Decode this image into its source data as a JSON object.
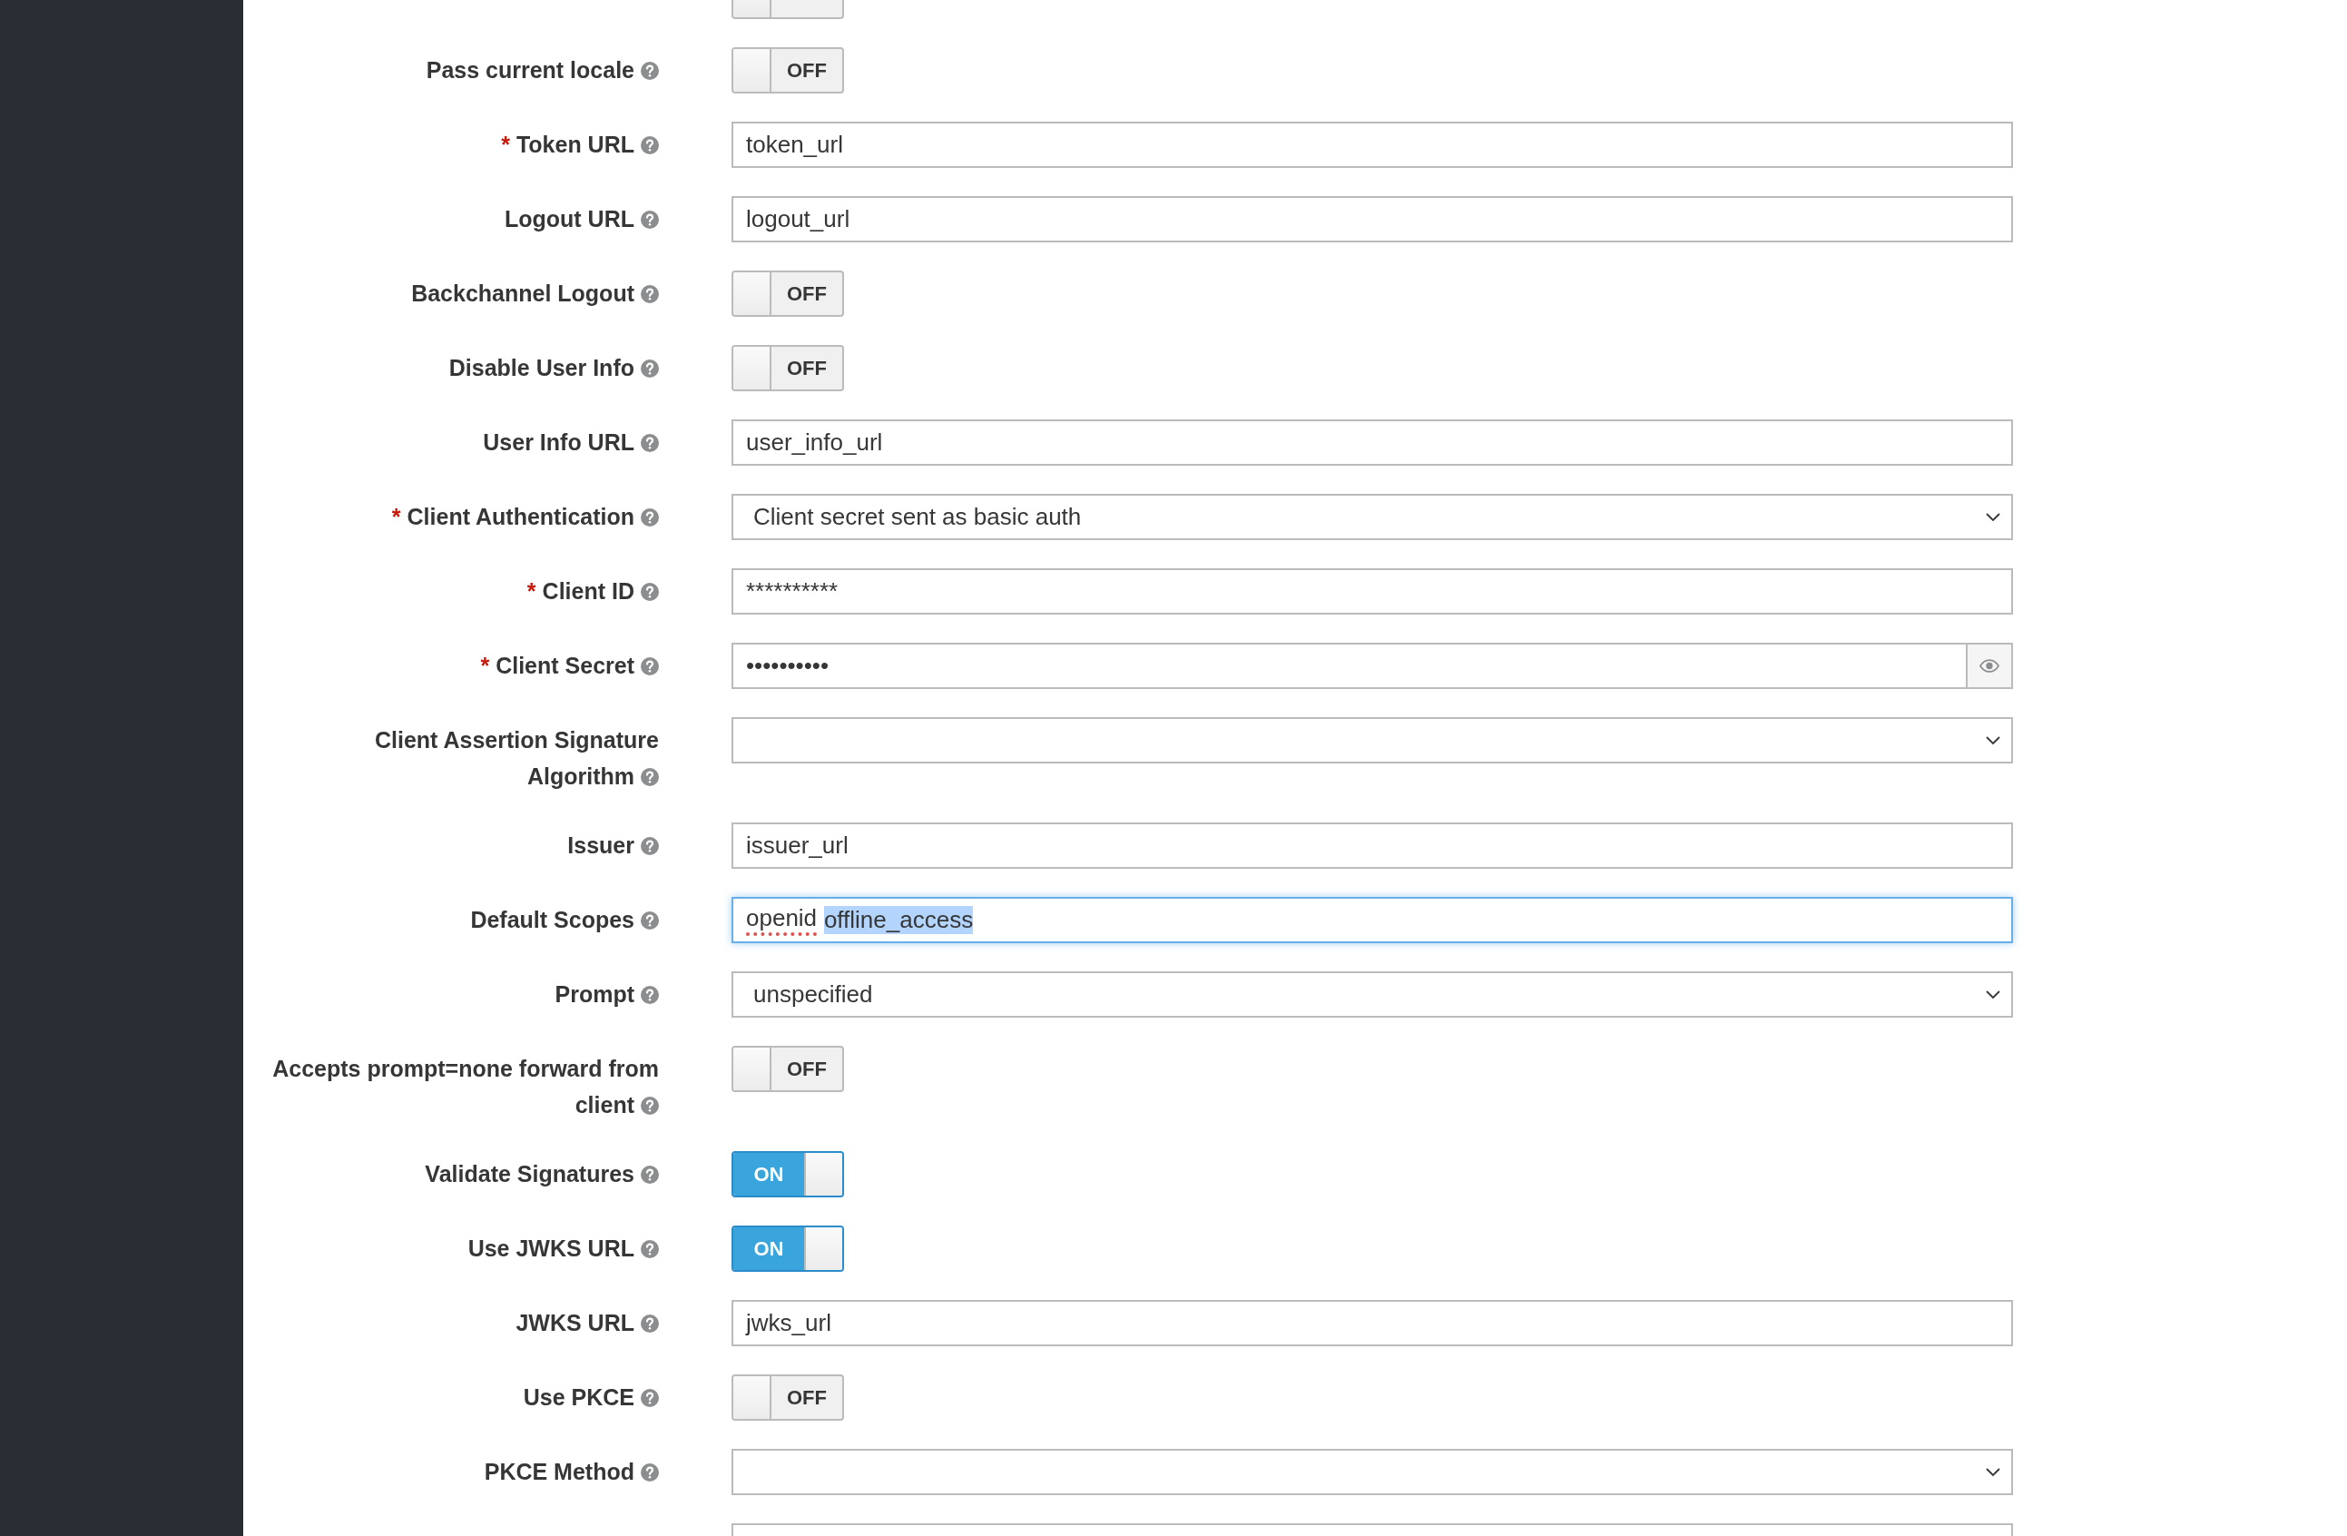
{
  "fields": [
    {
      "kind": "toggle",
      "on": false
    },
    {
      "label": "Pass current locale",
      "kind": "toggle",
      "on": false,
      "state_text": "OFF"
    },
    {
      "label": "Token URL",
      "required_mark": "*",
      "kind": "text",
      "value": "token_url"
    },
    {
      "label": "Logout URL",
      "kind": "text",
      "value": "logout_url"
    },
    {
      "label": "Backchannel Logout",
      "kind": "toggle",
      "on": false,
      "state_text": "OFF"
    },
    {
      "label": "Disable User Info",
      "kind": "toggle",
      "on": false,
      "state_text": "OFF"
    },
    {
      "label": "User Info URL",
      "kind": "text",
      "value": "user_info_url"
    },
    {
      "label": "Client Authentication",
      "required_mark": "*",
      "kind": "select",
      "value": "Client secret sent as basic auth"
    },
    {
      "label": "Client ID",
      "required_mark": "*",
      "kind": "text",
      "value": "**********"
    },
    {
      "label": "Client Secret",
      "required_mark": "*",
      "kind": "secret",
      "value": "••••••••••"
    },
    {
      "label": "Client Assertion Signature Algorithm",
      "kind": "select"
    },
    {
      "label": "Issuer",
      "kind": "text",
      "value": "issuer_url"
    },
    {
      "label": "Default Scopes",
      "kind": "segments",
      "focused": true,
      "segments": [
        {
          "text": "openid",
          "misspelled": true,
          "selected": false
        },
        {
          "text": "offline_access",
          "misspelled": false,
          "selected": true
        }
      ]
    },
    {
      "label": "Prompt",
      "kind": "select",
      "value": "unspecified"
    },
    {
      "label": "Accepts prompt=none forward from client",
      "kind": "toggle",
      "on": false,
      "state_text": "OFF"
    },
    {
      "label": "Validate Signatures",
      "kind": "toggle",
      "on": true,
      "state_text": "ON"
    },
    {
      "label": "Use JWKS URL",
      "kind": "toggle",
      "on": true,
      "state_text": "ON"
    },
    {
      "label": "JWKS URL",
      "kind": "text",
      "value": "jwks_url"
    },
    {
      "label": "Use PKCE",
      "kind": "toggle",
      "on": false,
      "state_text": "OFF"
    },
    {
      "label": "PKCE Method",
      "kind": "select"
    },
    {
      "kind": "text"
    }
  ]
}
